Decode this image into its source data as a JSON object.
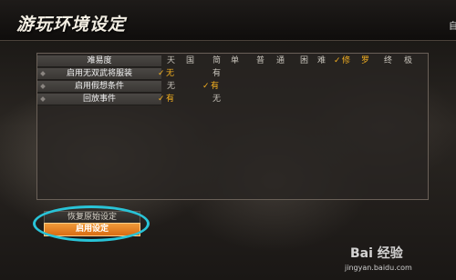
{
  "window": {
    "title": "游玩环境设定",
    "corner_text": "自"
  },
  "settings": [
    {
      "label": "难易度",
      "options": [
        "天",
        "国",
        "简",
        "单",
        "普",
        "通",
        "困",
        "难",
        "修",
        "罗",
        "终",
        "极"
      ],
      "selected": "修"
    },
    {
      "label": "启用无双武将服装",
      "options": [
        "无",
        "有"
      ],
      "selected": "无"
    },
    {
      "label": "启用假想条件",
      "options": [
        "无",
        "有"
      ],
      "selected": "有"
    },
    {
      "label": "回放事件",
      "options": [
        "有",
        "无"
      ],
      "selected": "有"
    }
  ],
  "buttons": {
    "restore_label": "恢复原始设定",
    "apply_label": "启用设定"
  },
  "watermark": {
    "text": "Bai 经验",
    "url": "jingyan.baidu.com"
  },
  "colors": {
    "selected": "#f4b020",
    "annotation_circle": "#29c4d8",
    "apply_button": "#e88428"
  }
}
